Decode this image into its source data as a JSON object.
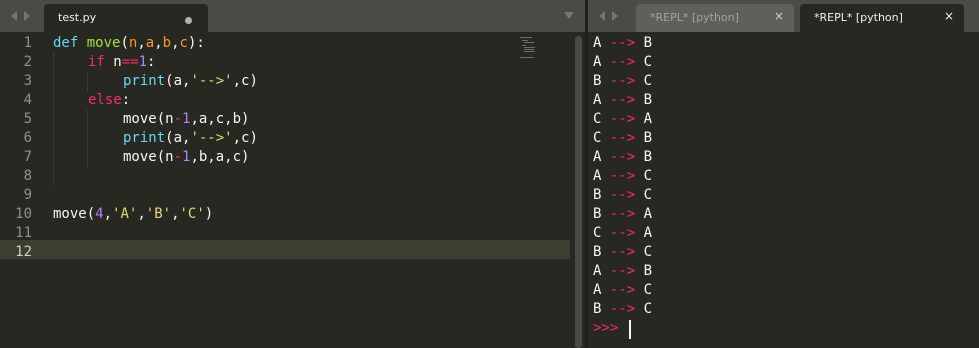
{
  "editor": {
    "tabs": [
      {
        "label": "test.py",
        "modified": true
      }
    ],
    "line_numbers": [
      "1",
      "2",
      "3",
      "4",
      "5",
      "6",
      "7",
      "8",
      "9",
      "10",
      "11",
      "12"
    ],
    "current_line": "12",
    "code": {
      "l1": {
        "def": "def",
        "name": "move",
        "open": "(",
        "p1": "n",
        "c1": ",",
        "p2": "a",
        "c2": ",",
        "p3": "b",
        "c3": ",",
        "p4": "c",
        "close": "):"
      },
      "l2": {
        "if": "if",
        "cond1": " n",
        "eq": "==",
        "one": "1",
        "colon": ":"
      },
      "l3": {
        "print": "print",
        "args1": "(a,",
        "str": "'-->'",
        "args2": ",c)"
      },
      "l4": {
        "else": "else",
        "colon": ":"
      },
      "l5": {
        "call": "move(n",
        "minus": "-",
        "one": "1",
        "rest": ",a,c,b)"
      },
      "l6": {
        "print": "print",
        "args1": "(a,",
        "str": "'-->'",
        "args2": ",c)"
      },
      "l7": {
        "call": "move(n",
        "minus": "-",
        "one": "1",
        "rest": ",b,a,c)"
      },
      "l10": {
        "call": "move(",
        "num": "4",
        "c1": ",",
        "s1": "'A'",
        "c2": ",",
        "s2": "'B'",
        "c3": ",",
        "s3": "'C'",
        "close": ")"
      }
    }
  },
  "repl": {
    "tabs": [
      {
        "label": "*REPL* [python]",
        "close": "×"
      },
      {
        "label": "*REPL* [python]",
        "close": "×"
      }
    ],
    "arrow": "-->",
    "moves": [
      [
        "A",
        "B"
      ],
      [
        "A",
        "C"
      ],
      [
        "B",
        "C"
      ],
      [
        "A",
        "B"
      ],
      [
        "C",
        "A"
      ],
      [
        "C",
        "B"
      ],
      [
        "A",
        "B"
      ],
      [
        "A",
        "C"
      ],
      [
        "B",
        "C"
      ],
      [
        "B",
        "A"
      ],
      [
        "C",
        "A"
      ],
      [
        "B",
        "C"
      ],
      [
        "A",
        "B"
      ],
      [
        "A",
        "C"
      ],
      [
        "B",
        "C"
      ]
    ],
    "prompt": ">>>"
  },
  "colors": {
    "background": "#272822",
    "tabbar": "#4a4b45",
    "keyword": "#f92672",
    "function": "#a6e22e",
    "builtin": "#66d9ef",
    "parameter": "#fd971f",
    "number": "#ae81ff",
    "string": "#e6db74",
    "text": "#f8f8f2"
  },
  "icons": {
    "tab_nav": "left-right-arrows-icon",
    "modified": "modified-dot-icon",
    "overflow": "tab-overflow-chevron-icon",
    "close": "close-icon"
  }
}
